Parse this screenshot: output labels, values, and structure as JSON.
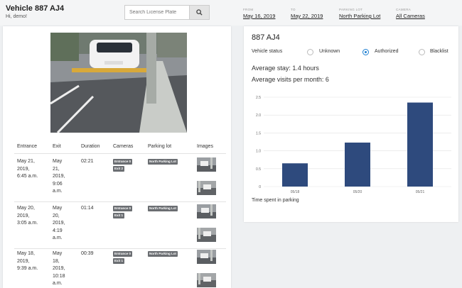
{
  "header": {
    "vehicle_title": "Vehicle 887 AJ4",
    "greeting": "Hi, demo!",
    "search_placeholder": "Search License Plate",
    "filters": [
      {
        "label": "FROM",
        "value": "May 16, 2019"
      },
      {
        "label": "TO",
        "value": "May 22, 2019"
      },
      {
        "label": "PARKING LOT",
        "value": "North Parking Lot"
      },
      {
        "label": "CAMERA",
        "value": "All Cameras"
      }
    ]
  },
  "visits": {
    "columns": [
      "Entrance",
      "Exit",
      "Duration",
      "Cameras",
      "Parking lot",
      "Images"
    ],
    "rows": [
      {
        "entrance": [
          "May 21,",
          "2019,",
          "6:45 a.m."
        ],
        "exit": [
          "May",
          "21,",
          "2019,",
          "9:06",
          "a.m."
        ],
        "duration": "02:21",
        "cameras": [
          "Entrance 0",
          "Exit 2"
        ],
        "lot": "North Parking Lot"
      },
      {
        "entrance": [
          "May 20,",
          "2019,",
          "3:05 a.m."
        ],
        "exit": [
          "May",
          "20,",
          "2019,",
          "4:19",
          "a.m."
        ],
        "duration": "01:14",
        "cameras": [
          "Entrance 0",
          "Exit 1"
        ],
        "lot": "North Parking Lot"
      },
      {
        "entrance": [
          "May 18,",
          "2019,",
          "9:39 a.m."
        ],
        "exit": [
          "May",
          "18,",
          "2019,",
          "10:18",
          "a.m."
        ],
        "duration": "00:39",
        "cameras": [
          "Entrance 0",
          "Exit 1"
        ],
        "lot": "North Parking Lot"
      }
    ]
  },
  "details": {
    "plate": "887 AJ4",
    "status_label": "Vehicle status",
    "status_options": [
      "Unknown",
      "Authorized",
      "Blacklist"
    ],
    "status_selected": "Authorized",
    "average_stay": "Average stay: 1.4 hours",
    "average_visits": "Average visits per month: 6",
    "chart_caption": "Time spent in parking"
  },
  "chart_data": {
    "type": "bar",
    "categories": [
      "05/18",
      "05/20",
      "05/21"
    ],
    "values": [
      0.65,
      1.23,
      2.35
    ],
    "ylim": [
      0,
      2.5
    ],
    "yticks": [
      "0",
      "0.5",
      "1.0",
      "1.5",
      "2.0",
      "2.5"
    ],
    "xlabel": "Time spent in parking",
    "ylabel": "",
    "grid": true,
    "bar_color": "#2e4a7d"
  },
  "colors": {
    "accent": "#1e7fd1",
    "tag": "#6b6e72"
  }
}
